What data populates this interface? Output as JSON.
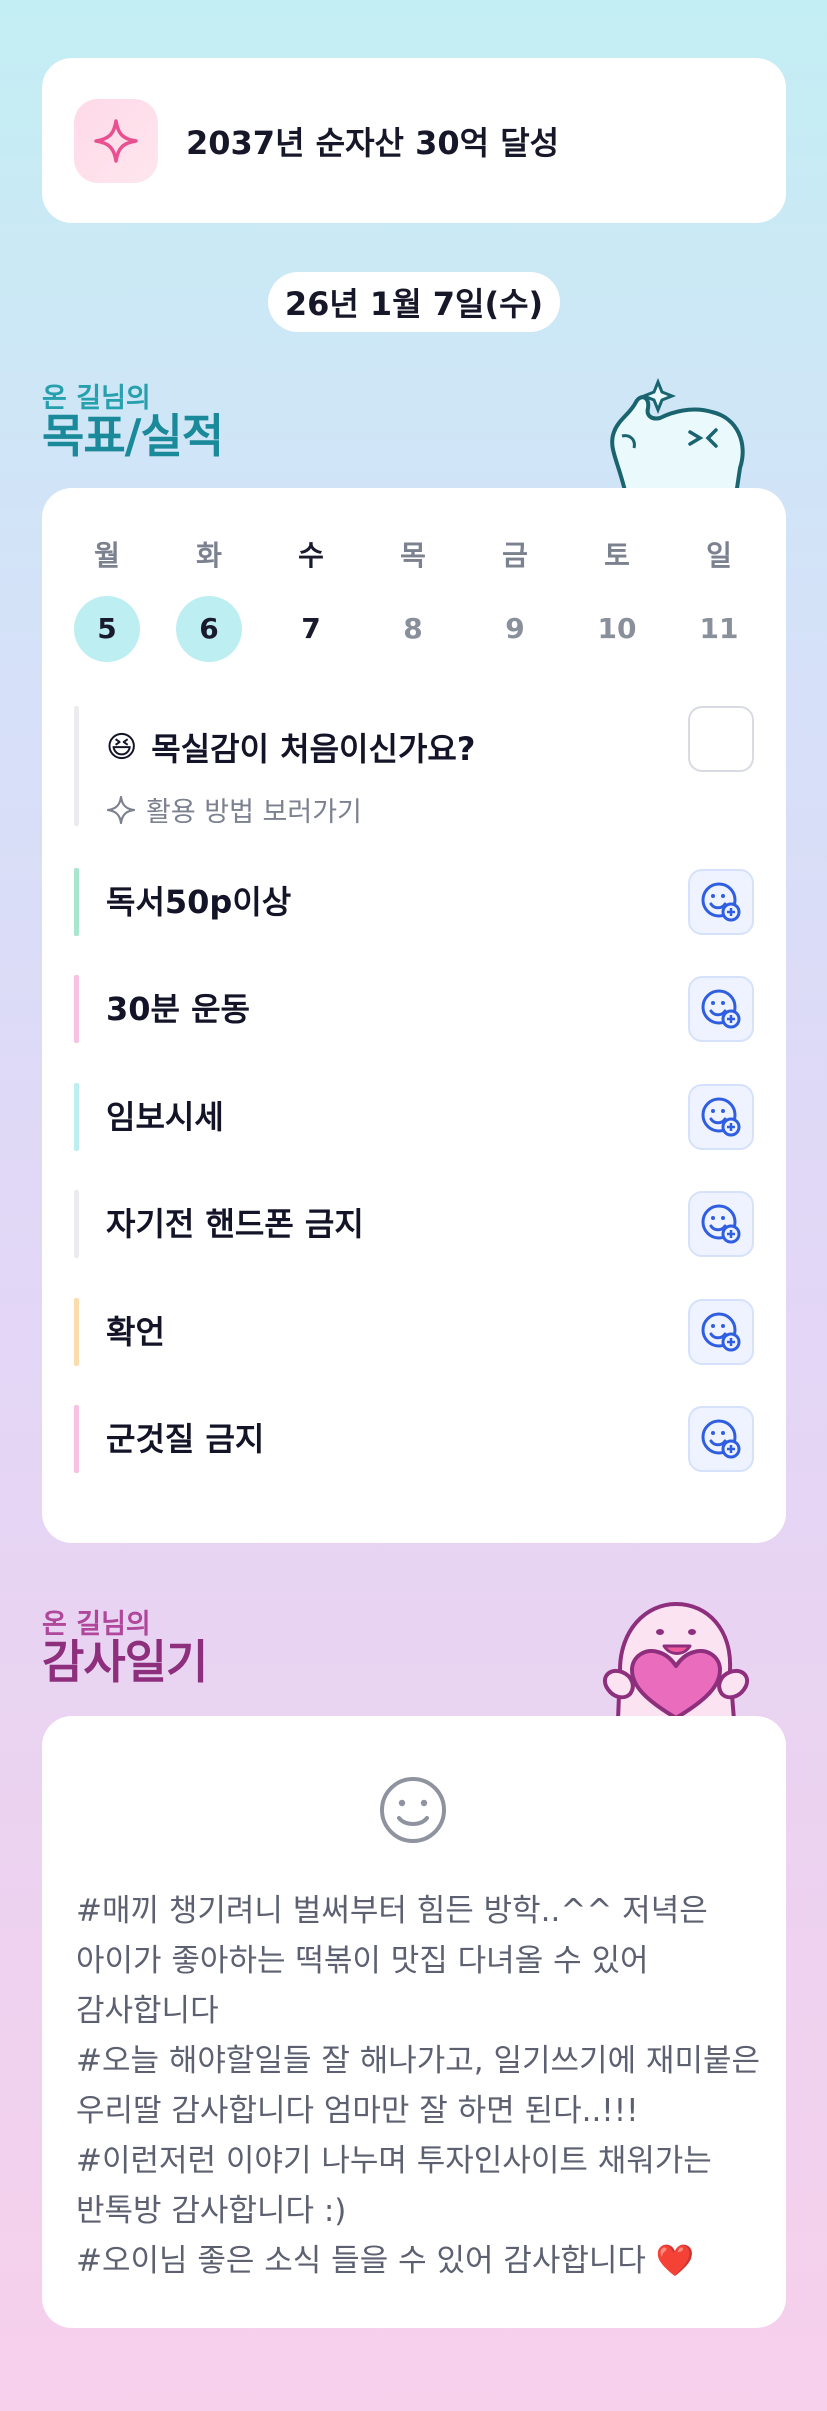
{
  "goal": {
    "text": "2037년 순자산 30억 달성",
    "icon": "sparkle-icon"
  },
  "date": {
    "label": "26년 1월 7일(수)"
  },
  "goals_section": {
    "small": "온 길님의",
    "title": "목표/실적"
  },
  "week": {
    "days": [
      {
        "name": "월",
        "num": "5",
        "state": "done"
      },
      {
        "name": "화",
        "num": "6",
        "state": "done"
      },
      {
        "name": "수",
        "num": "7",
        "state": "today"
      },
      {
        "name": "목",
        "num": "8",
        "state": "future"
      },
      {
        "name": "금",
        "num": "9",
        "state": "future"
      },
      {
        "name": "토",
        "num": "10",
        "state": "future"
      },
      {
        "name": "일",
        "num": "11",
        "state": "future"
      }
    ]
  },
  "intro": {
    "emoji": "😆",
    "title": "목실감이 처음이신가요?",
    "link": "활용 방법 보러가기"
  },
  "tasks": [
    {
      "title": "독서50p이상",
      "color": "#a8e6cf"
    },
    {
      "title": "30분 운동",
      "color": "#f7c1e3"
    },
    {
      "title": "임보시세",
      "color": "#bdeef2"
    },
    {
      "title": "자기전 핸드폰 금지",
      "color": "#ececef"
    },
    {
      "title": "확언",
      "color": "#fbdcae"
    },
    {
      "title": "군것질 금지",
      "color": "#f7c1e3"
    }
  ],
  "gratitude_section": {
    "small": "온 길님의",
    "title": "감사일기"
  },
  "gratitude": {
    "icon": "smiley-icon",
    "text": "#매끼 챙기려니 벌써부터 힘든 방학..^^ 저녁은 아이가 좋아하는 떡볶이 맛집 다녀올 수 있어 감사합니다\n#오늘 해야할일들 잘 해나가고, 일기쓰기에 재미붙은 우리딸 감사합니다 엄마만 잘 하면 된다..!!!\n#이런저런 이야기 나누며 투자인사이트 채워가는 반톡방 감사합니다 :)\n#오이님 좋은 소식 들을 수 있어 감사합니다 ❤️"
  },
  "colors": {
    "accent_teal": "#1a8a9a",
    "accent_plum": "#8e2f7d",
    "done_day": "#bdeef2",
    "emoji_btn": "#2f5fe0"
  }
}
